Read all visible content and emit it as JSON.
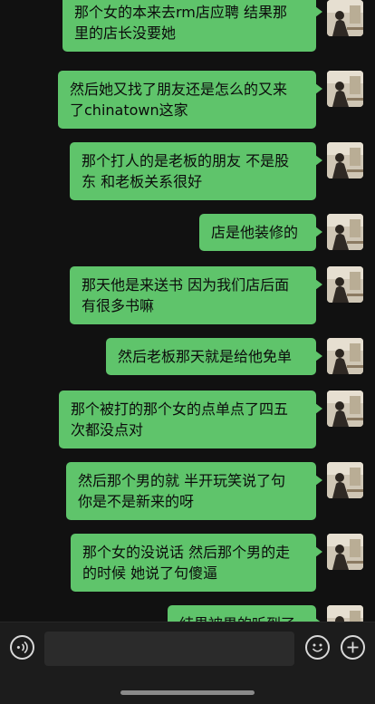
{
  "messages": [
    {
      "text": "那个女的本来去rm店应聘 结果那\n里的店长没要她"
    },
    {
      "text": "然后她又找了朋友还是怎么的又来\n了chinatown这家"
    },
    {
      "text": "那个打人的是老板的朋友 不是股\n东 和老板关系很好"
    },
    {
      "text": "店是他装修的"
    },
    {
      "text": "那天他是来送书 因为我们店后面\n有很多书嘛"
    },
    {
      "text": "然后老板那天就是给他免单"
    },
    {
      "text": "那个被打的那个女的点单点了四五\n次都没点对"
    },
    {
      "text": "然后那个男的就 半开玩笑说了句\n你是不是新来的呀"
    },
    {
      "text": "那个女的没说话 然后那个男的走\n的时候 她说了句傻逼"
    },
    {
      "text": "结果被男的听到了"
    }
  ],
  "input": {
    "placeholder": "",
    "value": ""
  },
  "icons": {
    "voice": "voice-icon",
    "emoji": "emoji-icon",
    "plus": "plus-icon"
  },
  "colors": {
    "background": "#111111",
    "bubble": "#5fc46b",
    "input_bar": "#1c1c1c"
  }
}
